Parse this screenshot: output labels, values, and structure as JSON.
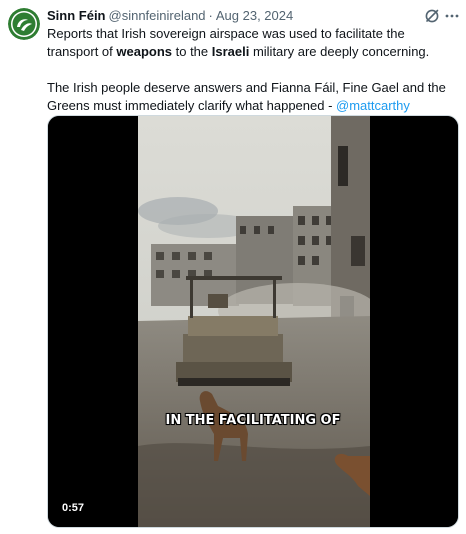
{
  "tweet": {
    "author_name": "Sinn Féin",
    "author_handle": "@sinnfeinireland",
    "separator": "·",
    "date": "Aug 23, 2024",
    "text": {
      "p1_part1": "Reports that Irish sovereign airspace was used to facilitate the transport of ",
      "p1_bold1": "weapons",
      "p1_part2": " to the ",
      "p1_bold2": "Israeli",
      "p1_part3": " military are deeply concerning.",
      "p2": "The Irish people deserve answers and Fianna Fáil, Fine Gael and the Greens must immediately clarify what happened - ",
      "mention": "@mattcarthy"
    }
  },
  "video": {
    "caption": "IN THE FACILITATING OF",
    "duration": "0:57"
  },
  "icons": {
    "avatar": "sinn-fein-logo",
    "grok": "grok-icon",
    "more": "more-icon"
  },
  "colors": {
    "brand_green": "#2e7d32",
    "link_blue": "#1d9bf0",
    "secondary_text": "#536471"
  }
}
